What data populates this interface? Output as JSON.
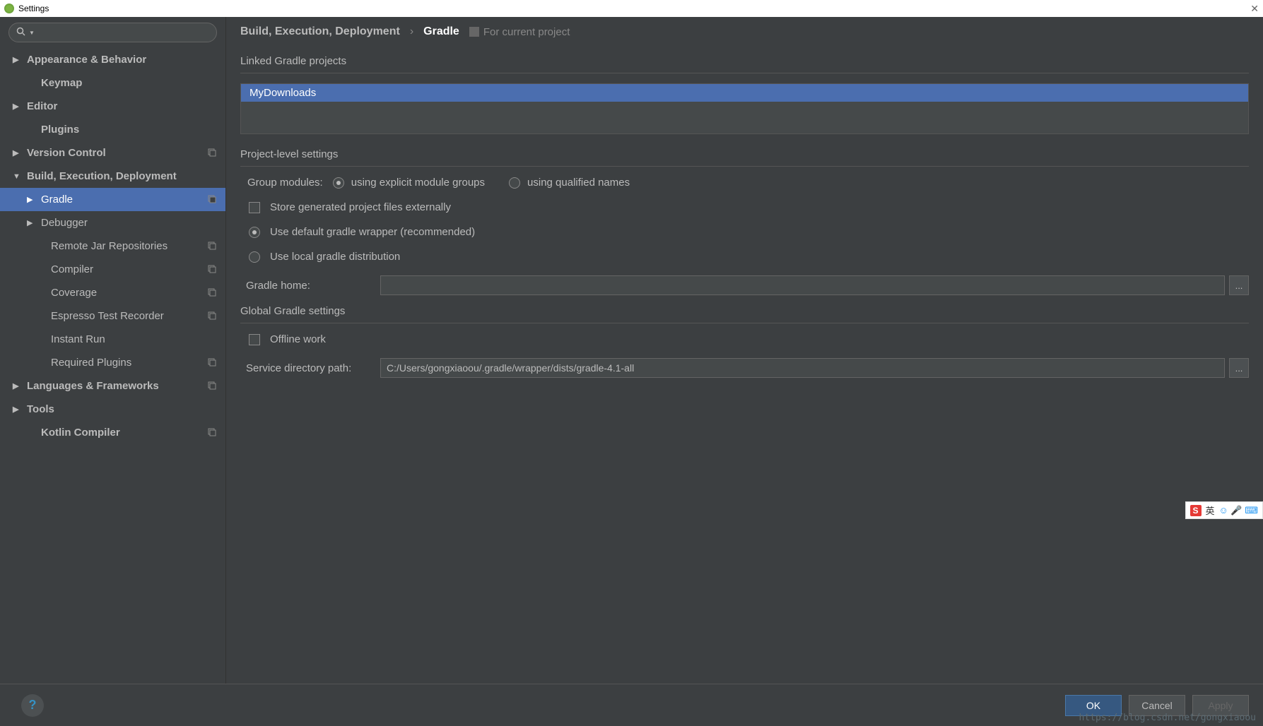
{
  "window": {
    "title": "Settings",
    "close": "✕"
  },
  "search": {
    "placeholder": ""
  },
  "tree": {
    "items": [
      {
        "label": "Appearance & Behavior",
        "expand": "▶",
        "bold": true,
        "indent": 0
      },
      {
        "label": "Keymap",
        "expand": "",
        "bold": true,
        "indent": 1
      },
      {
        "label": "Editor",
        "expand": "▶",
        "bold": true,
        "indent": 0
      },
      {
        "label": "Plugins",
        "expand": "",
        "bold": true,
        "indent": 1
      },
      {
        "label": "Version Control",
        "expand": "▶",
        "bold": true,
        "indent": 0,
        "copy": true
      },
      {
        "label": "Build, Execution, Deployment",
        "expand": "▼",
        "bold": true,
        "indent": 0
      },
      {
        "label": "Gradle",
        "expand": "▶",
        "bold": false,
        "indent": 1,
        "selected": true,
        "copy": true
      },
      {
        "label": "Debugger",
        "expand": "▶",
        "bold": false,
        "indent": 1
      },
      {
        "label": "Remote Jar Repositories",
        "expand": "",
        "bold": false,
        "indent": 2,
        "copy": true
      },
      {
        "label": "Compiler",
        "expand": "",
        "bold": false,
        "indent": 2,
        "copy": true
      },
      {
        "label": "Coverage",
        "expand": "",
        "bold": false,
        "indent": 2,
        "copy": true
      },
      {
        "label": "Espresso Test Recorder",
        "expand": "",
        "bold": false,
        "indent": 2,
        "copy": true
      },
      {
        "label": "Instant Run",
        "expand": "",
        "bold": false,
        "indent": 2
      },
      {
        "label": "Required Plugins",
        "expand": "",
        "bold": false,
        "indent": 2,
        "copy": true
      },
      {
        "label": "Languages & Frameworks",
        "expand": "▶",
        "bold": true,
        "indent": 0,
        "copy": true
      },
      {
        "label": "Tools",
        "expand": "▶",
        "bold": true,
        "indent": 0
      },
      {
        "label": "Kotlin Compiler",
        "expand": "",
        "bold": true,
        "indent": 1,
        "copy": true
      }
    ]
  },
  "breadcrumb": {
    "parent": "Build, Execution, Deployment",
    "sep": "›",
    "current": "Gradle",
    "project_hint": "For current project"
  },
  "sections": {
    "linked": "Linked Gradle projects",
    "project_level": "Project-level settings",
    "global": "Global Gradle settings"
  },
  "linked_project": "MyDownloads",
  "form": {
    "group_modules_label": "Group modules:",
    "radio_explicit": "using explicit module groups",
    "radio_qualified": "using qualified names",
    "store_external": "Store generated project files externally",
    "use_default_wrapper": "Use default gradle wrapper (recommended)",
    "use_local": "Use local gradle distribution",
    "gradle_home_label": "Gradle home:",
    "gradle_home_value": "",
    "offline_work": "Offline work",
    "service_dir_label": "Service directory path:",
    "service_dir_value": "C:/Users/gongxiaoou/.gradle/wrapper/dists/gradle-4.1-all",
    "browse": "..."
  },
  "buttons": {
    "ok": "OK",
    "cancel": "Cancel",
    "apply": "Apply",
    "help": "?"
  },
  "watermark": "https://blog.csdn.net/gongxiaoou",
  "ime": {
    "s": "S",
    "lang": "英"
  }
}
